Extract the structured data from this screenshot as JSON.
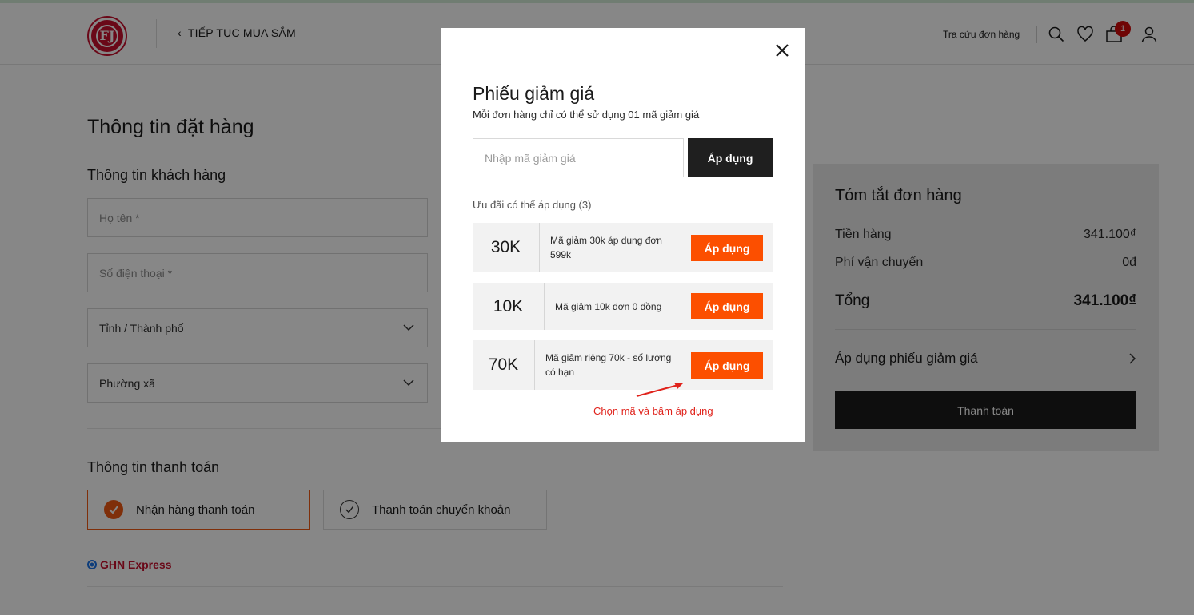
{
  "header": {
    "logo_text": "FJ",
    "continue_label": "TIẾP TỤC MUA SẮM",
    "order_lookup": "Tra cứu đơn hàng",
    "cart_count": "1",
    "icons": [
      "search-icon",
      "heart-icon",
      "cart-icon",
      "user-icon"
    ]
  },
  "order_form": {
    "title": "Thông tin đặt hàng",
    "customer_section": "Thông tin khách hàng",
    "name_placeholder": "Họ tên *",
    "phone_placeholder": "Số điện thoại *",
    "province_value": "Tỉnh / Thành phố",
    "ward_value": "Phường xã",
    "payment_section": "Thông tin thanh toán",
    "payment_options": [
      "Nhận hàng thanh toán",
      "Thanh toán chuyển khoản"
    ],
    "selected_payment": "Nhận hàng thanh toán",
    "shipping_option": "GHN Express"
  },
  "summary": {
    "title": "Tóm tắt đơn hàng",
    "subtotal_label": "Tiền hàng",
    "subtotal_value": "341.100₫",
    "shipping_label": "Phí vận chuyển",
    "shipping_value": "0đ",
    "total_label": "Tổng",
    "total_value": "341.100₫",
    "coupon_link": "Áp dụng phiếu giảm giá",
    "checkout_label": "Thanh toán"
  },
  "modal": {
    "title": "Phiếu giảm giá",
    "subtitle": "Mỗi đơn hàng chỉ có thể sử dụng 01 mã giảm giá",
    "input_placeholder": "Nhập mã giảm giá",
    "input_value": "",
    "apply_label": "Áp dụng",
    "offers_label": "Ưu đãi có thể áp dụng (3)",
    "coupons": [
      {
        "amount": "30K",
        "description": "Mã giảm 30k áp dụng đơn 599k",
        "button": "Áp dụng"
      },
      {
        "amount": "10K",
        "description": "Mã giảm 10k đơn 0 đồng",
        "button": "Áp dụng"
      },
      {
        "amount": "70K",
        "description": "Mã giảm riêng 70k - số lượng có hạn",
        "button": "Áp dụng"
      }
    ],
    "hint": "Chọn mã và bấm áp dụng"
  },
  "colors": {
    "accent_orange": "#fc4f00",
    "brand_red": "#c8102e",
    "dark": "#1f1f1f",
    "hint_red": "#e0231c"
  }
}
